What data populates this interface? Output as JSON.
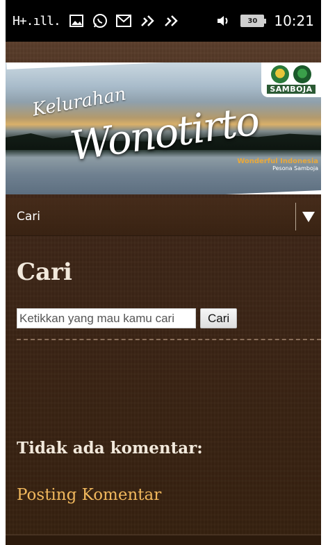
{
  "status_bar": {
    "signal": "H+.ıll.",
    "battery_level": "30",
    "time": "10:21",
    "icons": [
      "image-icon",
      "whatsapp-icon",
      "gmail-icon",
      "missed-call-icon",
      "missed-call-icon",
      "volume-icon"
    ]
  },
  "banner": {
    "title_small": "Kelurahan",
    "title_big": "Wonotirto",
    "logo_text": "SAMBOJA",
    "tourism_brand": "Wonderful Indonesia",
    "tourism_sub": "Pesona Samboja"
  },
  "nav": {
    "label": "Cari",
    "toggle_icon": "triangle-down-icon"
  },
  "page": {
    "title": "Cari",
    "search_placeholder": "Ketikkan yang mau kamu cari",
    "search_button": "Cari",
    "comments_title": "Tidak ada komentar:",
    "post_comment_link": "Posting Komentar"
  },
  "colors": {
    "background": "#3d2617",
    "link": "#f1b85d",
    "heading": "#f2e9dc"
  }
}
